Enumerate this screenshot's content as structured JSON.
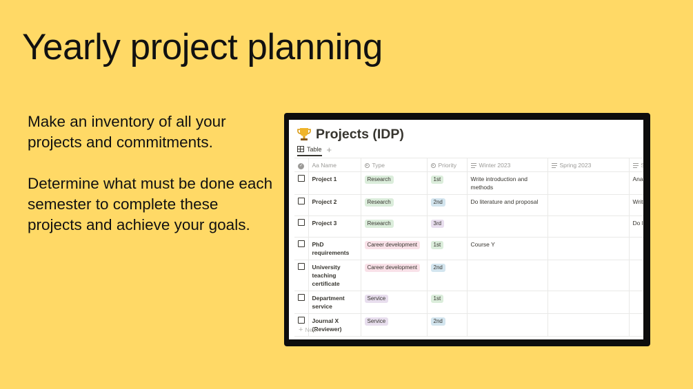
{
  "slide": {
    "title": "Yearly project planning",
    "paragraphs": [
      "Make an inventory of all your projects and commitments.",
      "Determine what must be done each semester to complete these projects and achieve your goals."
    ]
  },
  "database": {
    "icon": "trophy-icon",
    "title": "Projects (IDP)",
    "view_tab": "Table",
    "add_view_label": "+",
    "columns": [
      "Aa Name",
      "Type",
      "Priority",
      "Winter 2023",
      "Spring 2023",
      "Su"
    ],
    "rows": [
      {
        "name": "Project 1",
        "type": "Research",
        "priority": "1st",
        "winter": "Write introduction and methods",
        "spring": "",
        "summer": "Analyz results"
      },
      {
        "name": "Project 2",
        "type": "Research",
        "priority": "2nd",
        "winter": "Do literature and proposal",
        "spring": "",
        "summer": "Write metho"
      },
      {
        "name": "Project 3",
        "type": "Research",
        "priority": "3rd",
        "winter": "",
        "spring": "",
        "summer": "Do lite propo"
      },
      {
        "name": "PhD requirements",
        "type": "Career development",
        "priority": "1st",
        "winter": "Course Y",
        "spring": "",
        "summer": ""
      },
      {
        "name": "University teaching certificate",
        "type": "Career development",
        "priority": "2nd",
        "winter": "",
        "spring": "",
        "summer": ""
      },
      {
        "name": "Department service",
        "type": "Service",
        "priority": "1st",
        "winter": "",
        "spring": "",
        "summer": ""
      },
      {
        "name": "Journal X (Reviewer)",
        "type": "Service",
        "priority": "2nd",
        "winter": "",
        "spring": "",
        "summer": ""
      }
    ],
    "new_label": "New"
  },
  "colors": {
    "background": "#FFD966",
    "tag_research": "#dbeddb",
    "tag_career": "#f9e1e8",
    "tag_service": "#e8deee",
    "priority_1st": "#dbeddb",
    "priority_2nd": "#d3e5ef",
    "priority_3rd": "#e8deee"
  }
}
